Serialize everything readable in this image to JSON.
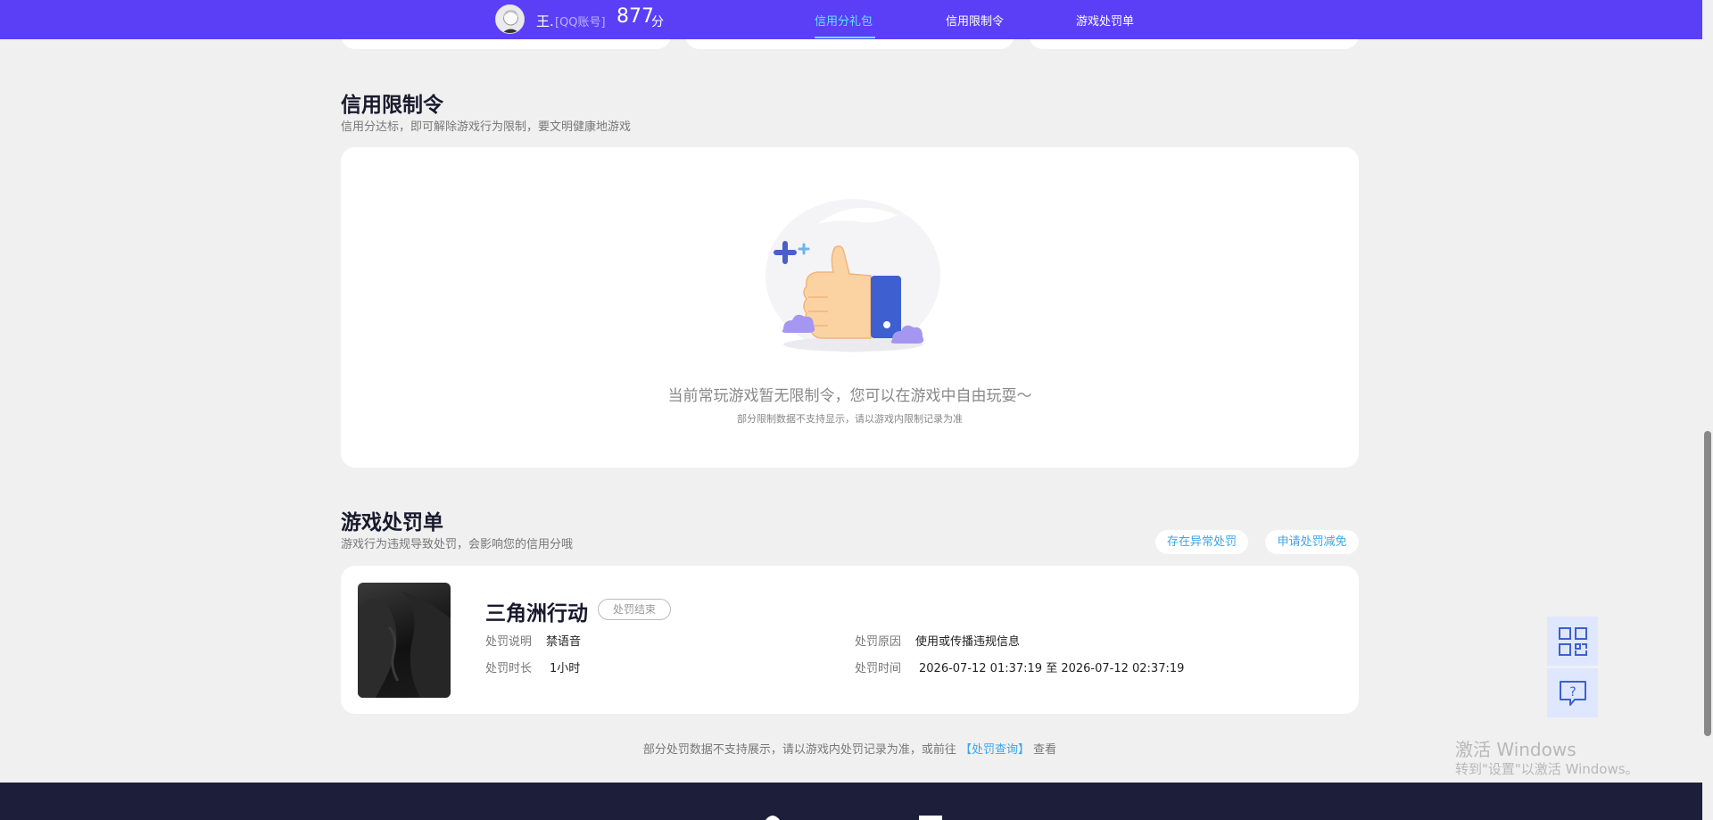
{
  "header": {
    "username": "王.",
    "account_tag": "[QQ账号]",
    "score": "877",
    "score_unit": "分",
    "tabs": [
      {
        "label": "信用分礼包",
        "active": true
      },
      {
        "label": "信用限制令",
        "active": false
      },
      {
        "label": "游戏处罚单",
        "active": false
      }
    ]
  },
  "restriction": {
    "title": "信用限制令",
    "subtitle": "信用分达标，即可解除游戏行为限制，要文明健康地游戏",
    "empty_main": "当前常玩游戏暂无限制令，您可以在游戏中自由玩耍～",
    "empty_note": "部分限制数据不支持显示，请以游戏内限制记录为准"
  },
  "penalty": {
    "title": "游戏处罚单",
    "subtitle": "游戏行为违规导致处罚，会影响您的信用分哦",
    "btn_abnormal": "存在异常处罚",
    "btn_appeal": "申请处罚减免",
    "record": {
      "game_name": "三角洲行动",
      "status": "处罚结束",
      "desc_label": "处罚说明",
      "desc_value": "禁语音",
      "duration_label": "处罚时长",
      "duration_value": "1小时",
      "reason_label": "处罚原因",
      "reason_value": "使用或传播违规信息",
      "time_label": "处罚时间",
      "time_value": "2026-07-12 01:37:19 至 2026-07-12 02:37:19"
    },
    "bottom_note_prefix": "部分处罚数据不支持展示，请以游戏内处罚记录为准，或前往",
    "bottom_note_link": "【处罚查询】",
    "bottom_note_suffix": "查看"
  },
  "watermark": {
    "line1": "激活 Windows",
    "line2": "转到\"设置\"以激活 Windows。"
  },
  "icons": [
    "qr-code-icon",
    "help-chat-icon",
    "thumbs-up-illustration"
  ],
  "colors": {
    "nav_bg": "#5b3ff7",
    "active_tab": "#5ee8ff",
    "link": "#3da5e8",
    "footer_bg": "#1d1f3a"
  }
}
